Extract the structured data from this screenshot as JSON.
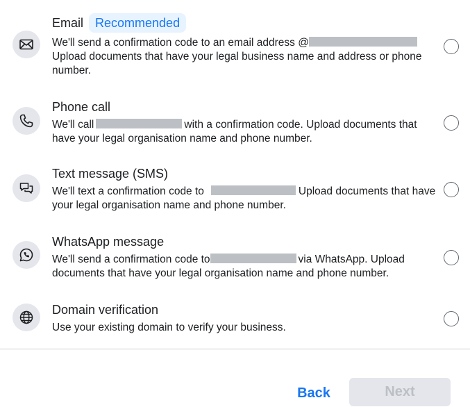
{
  "options": [
    {
      "title": "Email",
      "badge": "Recommended",
      "desc_part1": "We'll send a confirmation code to an email address @",
      "desc_part2": "Upload documents that have your legal business name and address or phone number.",
      "icon": "envelope-icon"
    },
    {
      "title": "Phone call",
      "desc_part1": "We'll call",
      "desc_part2": "with a confirmation code. Upload documents that have your legal organisation name and phone number.",
      "icon": "phone-icon"
    },
    {
      "title": "Text message (SMS)",
      "desc_part1": "We'll text a confirmation code to",
      "desc_part2": "Upload documents that have your legal organisation name and phone number.",
      "icon": "chat-bubbles-icon"
    },
    {
      "title": "WhatsApp message",
      "desc_part1": "We'll send a confirmation code to",
      "desc_part2": "via WhatsApp. Upload documents that have your legal organisation name and phone number.",
      "icon": "whatsapp-icon"
    },
    {
      "title": "Domain verification",
      "desc_part1": "Use your existing domain to verify your business.",
      "icon": "globe-icon"
    }
  ],
  "footer": {
    "back_label": "Back",
    "next_label": "Next",
    "next_disabled": true
  },
  "colors": {
    "accent": "#1877f2",
    "badge_bg": "#e7f3ff",
    "icon_bg": "#e4e6eb",
    "redaction": "#bcc0c4"
  }
}
